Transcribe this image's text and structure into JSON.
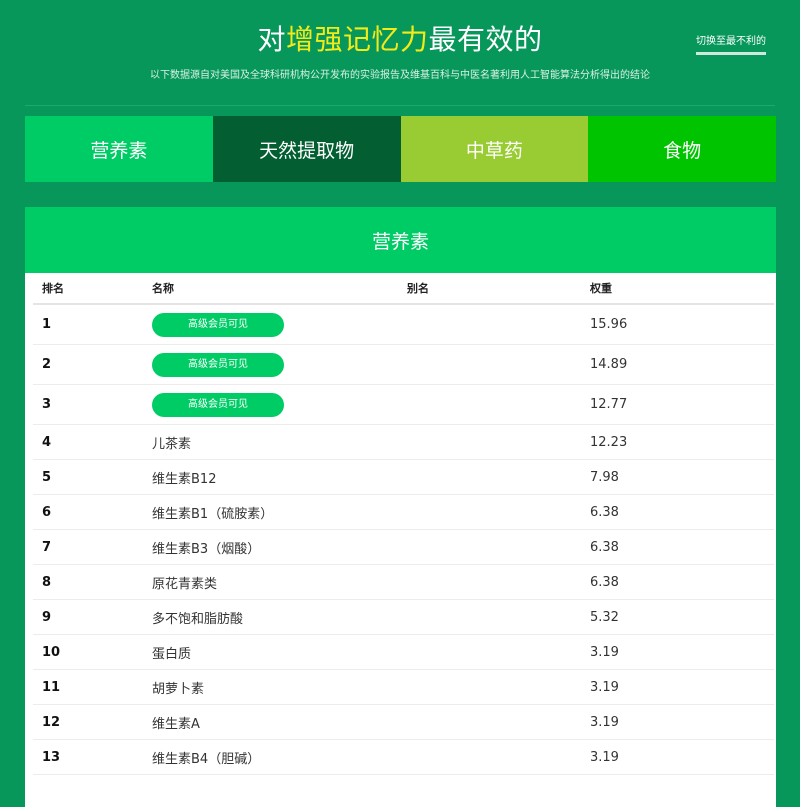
{
  "header": {
    "title_prefix": "对",
    "title_highlight": "增强记忆力",
    "title_suffix": "最有效的",
    "subtitle": "以下数据源自对美国及全球科研机构公开发布的实验报告及维基百科与中医名著利用人工智能算法分析得出的结论",
    "switch_link": "切换至最不利的"
  },
  "tabs": [
    {
      "label": "营养素",
      "color": "#00cc66"
    },
    {
      "label": "天然提取物",
      "color": "#035f32"
    },
    {
      "label": "中草药",
      "color": "#99cc33"
    },
    {
      "label": "食物",
      "color": "#00c400"
    }
  ],
  "panel": {
    "title": "营养素",
    "columns": {
      "rank": "排名",
      "name": "名称",
      "alias": "别名",
      "weight": "权重"
    },
    "rows": [
      {
        "rank": "1",
        "name": "高级会员可见",
        "locked": true,
        "alias": "",
        "weight": "15.96"
      },
      {
        "rank": "2",
        "name": "高级会员可见",
        "locked": true,
        "alias": "",
        "weight": "14.89"
      },
      {
        "rank": "3",
        "name": "高级会员可见",
        "locked": true,
        "alias": "",
        "weight": "12.77"
      },
      {
        "rank": "4",
        "name": "儿茶素",
        "locked": false,
        "alias": "",
        "weight": "12.23"
      },
      {
        "rank": "5",
        "name": "维生素B12",
        "locked": false,
        "alias": "",
        "weight": "7.98"
      },
      {
        "rank": "6",
        "name": "维生素B1（硫胺素）",
        "locked": false,
        "alias": "",
        "weight": "6.38"
      },
      {
        "rank": "7",
        "name": "维生素B3（烟酸）",
        "locked": false,
        "alias": "",
        "weight": "6.38"
      },
      {
        "rank": "8",
        "name": "原花青素类",
        "locked": false,
        "alias": "",
        "weight": "6.38"
      },
      {
        "rank": "9",
        "name": "多不饱和脂肪酸",
        "locked": false,
        "alias": "",
        "weight": "5.32"
      },
      {
        "rank": "10",
        "name": "蛋白质",
        "locked": false,
        "alias": "",
        "weight": "3.19"
      },
      {
        "rank": "11",
        "name": "胡萝卜素",
        "locked": false,
        "alias": "",
        "weight": "3.19"
      },
      {
        "rank": "12",
        "name": "维生素A",
        "locked": false,
        "alias": "",
        "weight": "3.19"
      },
      {
        "rank": "13",
        "name": "维生素B4（胆碱）",
        "locked": false,
        "alias": "",
        "weight": "3.19"
      }
    ]
  }
}
